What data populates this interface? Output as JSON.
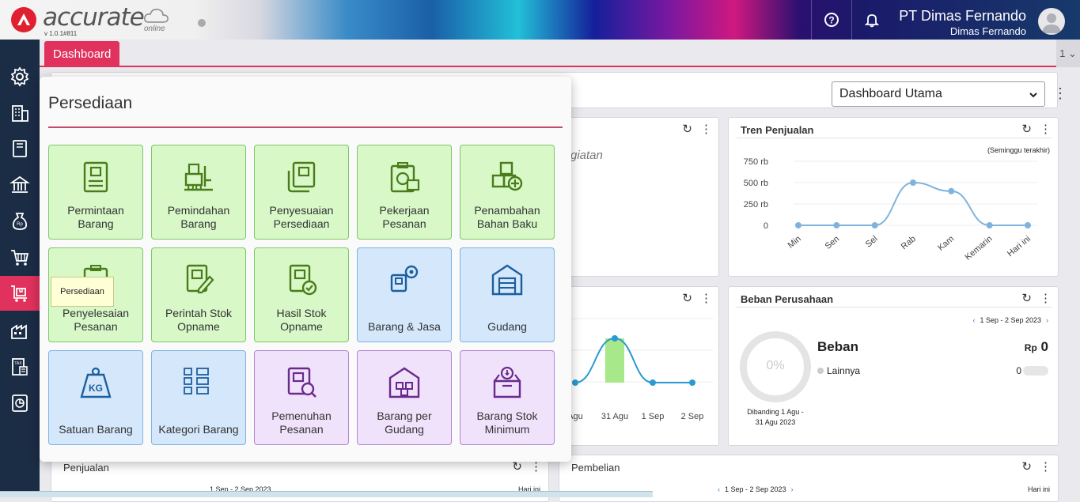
{
  "header": {
    "brand": "accurate",
    "brand_sub": "online",
    "version": "v 1.0.1#811",
    "company": "PT Dimas Fernando",
    "user": "Dimas Fernando"
  },
  "tabs": {
    "dashboard": "Dashboard",
    "count": "1 ⌄"
  },
  "dashboard_select": "Dashboard Utama",
  "panel": {
    "title": "Persediaan",
    "tooltip": "Persediaan",
    "tiles": [
      {
        "label1": "Permintaan",
        "label2": "Barang"
      },
      {
        "label1": "Pemindahan",
        "label2": "Barang"
      },
      {
        "label1": "Penyesuaian",
        "label2": "Persediaan"
      },
      {
        "label1": "Pekerjaan",
        "label2": "Pesanan"
      },
      {
        "label1": "Penambahan",
        "label2": "Bahan Baku"
      },
      {
        "label1": "Penyelesaian",
        "label2": "Pesanan"
      },
      {
        "label1": "Perintah Stok",
        "label2": "Opname"
      },
      {
        "label1": "Hasil Stok",
        "label2": "Opname"
      },
      {
        "label1": "Barang & Jasa",
        "label2": ""
      },
      {
        "label1": "Gudang",
        "label2": ""
      },
      {
        "label1": "Satuan Barang",
        "label2": ""
      },
      {
        "label1": "Kategori Barang",
        "label2": ""
      },
      {
        "label1": "Pemenuhan",
        "label2": "Pesanan"
      },
      {
        "label1": "Barang per",
        "label2": "Gudang"
      },
      {
        "label1": "Barang Stok",
        "label2": "Minimum"
      }
    ]
  },
  "cards": {
    "kegiatan_text": "giatan",
    "tren": {
      "title": "Tren Penjualan",
      "note": "(Seminggu terakhir)"
    },
    "beban": {
      "title": "Beban Perusahaan",
      "range": "1 Sep - 2 Sep 2023",
      "pct": "0%",
      "heading": "Beban",
      "currency": "Rp",
      "total": "0",
      "item_label": "Lainnya",
      "item_value": "0",
      "compare": "Dibanding 1 Agu -",
      "compare2": "31 Agu 2023"
    },
    "penjualan": {
      "title": "Penjualan",
      "range": "1 Sep - 2 Sep 2023",
      "hari": "Hari ini"
    },
    "pembelian": {
      "title": "Pembelian",
      "range": "1 Sep - 2 Sep 2023",
      "hari": "Hari ini"
    }
  },
  "chart_data": [
    {
      "type": "line",
      "title": "Tren Penjualan",
      "subtitle": "(Seminggu terakhir)",
      "categories": [
        "Min",
        "Sen",
        "Sel",
        "Rab",
        "Kam",
        "Kemarin",
        "Hari ini"
      ],
      "values": [
        0,
        0,
        0,
        500000,
        400000,
        0,
        0
      ],
      "yticks": [
        "0",
        "250 rb",
        "500 rb",
        "750 rb"
      ],
      "ylim": [
        0,
        750000
      ]
    },
    {
      "type": "bar",
      "categories": [
        "Agu",
        "31 Agu",
        "1 Sep",
        "2 Sep"
      ],
      "values": [
        0,
        1,
        0,
        0
      ],
      "line_values": [
        0,
        1,
        0,
        0
      ]
    }
  ],
  "status_url": "https://account.accurate.id/accurate/?..."
}
